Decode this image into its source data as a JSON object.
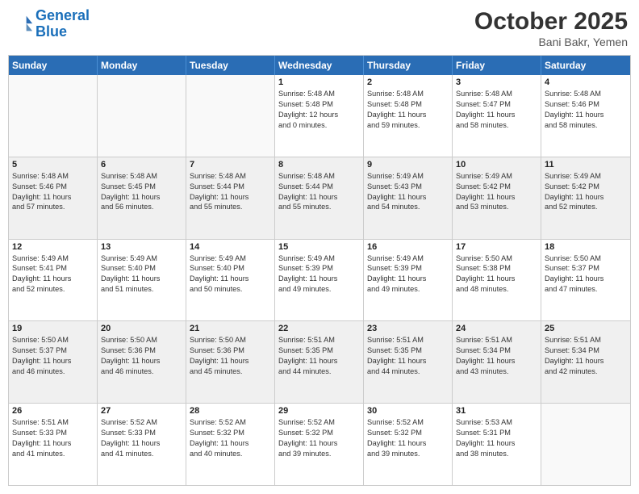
{
  "header": {
    "logo_line1": "General",
    "logo_line2": "Blue",
    "month": "October 2025",
    "location": "Bani Bakr, Yemen"
  },
  "weekdays": [
    "Sunday",
    "Monday",
    "Tuesday",
    "Wednesday",
    "Thursday",
    "Friday",
    "Saturday"
  ],
  "rows": [
    [
      {
        "day": "",
        "lines": [],
        "empty": true
      },
      {
        "day": "",
        "lines": [],
        "empty": true
      },
      {
        "day": "",
        "lines": [],
        "empty": true
      },
      {
        "day": "1",
        "lines": [
          "Sunrise: 5:48 AM",
          "Sunset: 5:48 PM",
          "Daylight: 12 hours",
          "and 0 minutes."
        ]
      },
      {
        "day": "2",
        "lines": [
          "Sunrise: 5:48 AM",
          "Sunset: 5:48 PM",
          "Daylight: 11 hours",
          "and 59 minutes."
        ]
      },
      {
        "day": "3",
        "lines": [
          "Sunrise: 5:48 AM",
          "Sunset: 5:47 PM",
          "Daylight: 11 hours",
          "and 58 minutes."
        ]
      },
      {
        "day": "4",
        "lines": [
          "Sunrise: 5:48 AM",
          "Sunset: 5:46 PM",
          "Daylight: 11 hours",
          "and 58 minutes."
        ]
      }
    ],
    [
      {
        "day": "5",
        "lines": [
          "Sunrise: 5:48 AM",
          "Sunset: 5:46 PM",
          "Daylight: 11 hours",
          "and 57 minutes."
        ]
      },
      {
        "day": "6",
        "lines": [
          "Sunrise: 5:48 AM",
          "Sunset: 5:45 PM",
          "Daylight: 11 hours",
          "and 56 minutes."
        ]
      },
      {
        "day": "7",
        "lines": [
          "Sunrise: 5:48 AM",
          "Sunset: 5:44 PM",
          "Daylight: 11 hours",
          "and 55 minutes."
        ]
      },
      {
        "day": "8",
        "lines": [
          "Sunrise: 5:48 AM",
          "Sunset: 5:44 PM",
          "Daylight: 11 hours",
          "and 55 minutes."
        ]
      },
      {
        "day": "9",
        "lines": [
          "Sunrise: 5:49 AM",
          "Sunset: 5:43 PM",
          "Daylight: 11 hours",
          "and 54 minutes."
        ]
      },
      {
        "day": "10",
        "lines": [
          "Sunrise: 5:49 AM",
          "Sunset: 5:42 PM",
          "Daylight: 11 hours",
          "and 53 minutes."
        ]
      },
      {
        "day": "11",
        "lines": [
          "Sunrise: 5:49 AM",
          "Sunset: 5:42 PM",
          "Daylight: 11 hours",
          "and 52 minutes."
        ]
      }
    ],
    [
      {
        "day": "12",
        "lines": [
          "Sunrise: 5:49 AM",
          "Sunset: 5:41 PM",
          "Daylight: 11 hours",
          "and 52 minutes."
        ]
      },
      {
        "day": "13",
        "lines": [
          "Sunrise: 5:49 AM",
          "Sunset: 5:40 PM",
          "Daylight: 11 hours",
          "and 51 minutes."
        ]
      },
      {
        "day": "14",
        "lines": [
          "Sunrise: 5:49 AM",
          "Sunset: 5:40 PM",
          "Daylight: 11 hours",
          "and 50 minutes."
        ]
      },
      {
        "day": "15",
        "lines": [
          "Sunrise: 5:49 AM",
          "Sunset: 5:39 PM",
          "Daylight: 11 hours",
          "and 49 minutes."
        ]
      },
      {
        "day": "16",
        "lines": [
          "Sunrise: 5:49 AM",
          "Sunset: 5:39 PM",
          "Daylight: 11 hours",
          "and 49 minutes."
        ]
      },
      {
        "day": "17",
        "lines": [
          "Sunrise: 5:50 AM",
          "Sunset: 5:38 PM",
          "Daylight: 11 hours",
          "and 48 minutes."
        ]
      },
      {
        "day": "18",
        "lines": [
          "Sunrise: 5:50 AM",
          "Sunset: 5:37 PM",
          "Daylight: 11 hours",
          "and 47 minutes."
        ]
      }
    ],
    [
      {
        "day": "19",
        "lines": [
          "Sunrise: 5:50 AM",
          "Sunset: 5:37 PM",
          "Daylight: 11 hours",
          "and 46 minutes."
        ]
      },
      {
        "day": "20",
        "lines": [
          "Sunrise: 5:50 AM",
          "Sunset: 5:36 PM",
          "Daylight: 11 hours",
          "and 46 minutes."
        ]
      },
      {
        "day": "21",
        "lines": [
          "Sunrise: 5:50 AM",
          "Sunset: 5:36 PM",
          "Daylight: 11 hours",
          "and 45 minutes."
        ]
      },
      {
        "day": "22",
        "lines": [
          "Sunrise: 5:51 AM",
          "Sunset: 5:35 PM",
          "Daylight: 11 hours",
          "and 44 minutes."
        ]
      },
      {
        "day": "23",
        "lines": [
          "Sunrise: 5:51 AM",
          "Sunset: 5:35 PM",
          "Daylight: 11 hours",
          "and 44 minutes."
        ]
      },
      {
        "day": "24",
        "lines": [
          "Sunrise: 5:51 AM",
          "Sunset: 5:34 PM",
          "Daylight: 11 hours",
          "and 43 minutes."
        ]
      },
      {
        "day": "25",
        "lines": [
          "Sunrise: 5:51 AM",
          "Sunset: 5:34 PM",
          "Daylight: 11 hours",
          "and 42 minutes."
        ]
      }
    ],
    [
      {
        "day": "26",
        "lines": [
          "Sunrise: 5:51 AM",
          "Sunset: 5:33 PM",
          "Daylight: 11 hours",
          "and 41 minutes."
        ]
      },
      {
        "day": "27",
        "lines": [
          "Sunrise: 5:52 AM",
          "Sunset: 5:33 PM",
          "Daylight: 11 hours",
          "and 41 minutes."
        ]
      },
      {
        "day": "28",
        "lines": [
          "Sunrise: 5:52 AM",
          "Sunset: 5:32 PM",
          "Daylight: 11 hours",
          "and 40 minutes."
        ]
      },
      {
        "day": "29",
        "lines": [
          "Sunrise: 5:52 AM",
          "Sunset: 5:32 PM",
          "Daylight: 11 hours",
          "and 39 minutes."
        ]
      },
      {
        "day": "30",
        "lines": [
          "Sunrise: 5:52 AM",
          "Sunset: 5:32 PM",
          "Daylight: 11 hours",
          "and 39 minutes."
        ]
      },
      {
        "day": "31",
        "lines": [
          "Sunrise: 5:53 AM",
          "Sunset: 5:31 PM",
          "Daylight: 11 hours",
          "and 38 minutes."
        ]
      },
      {
        "day": "",
        "lines": [],
        "empty": true
      }
    ]
  ]
}
